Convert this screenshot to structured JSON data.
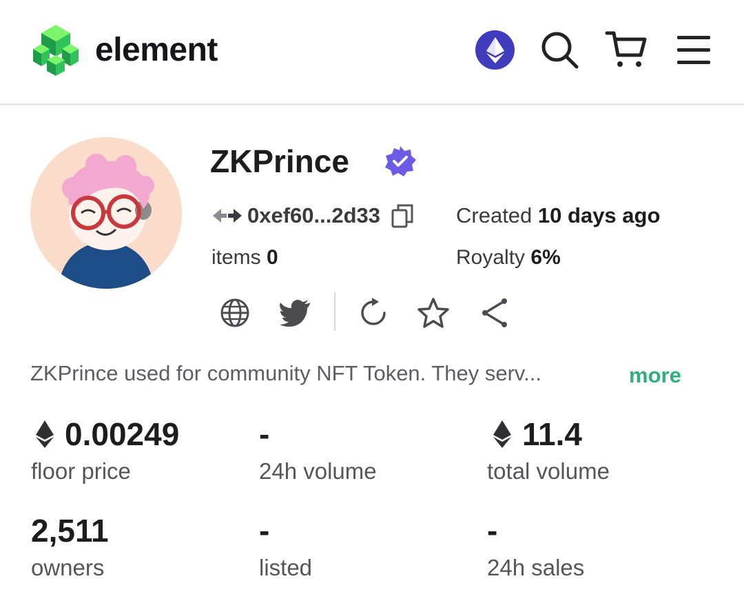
{
  "header": {
    "brand": "element",
    "icons": [
      "ethereum-network-icon",
      "search-icon",
      "cart-icon",
      "menu-icon"
    ]
  },
  "collection": {
    "name": "ZKPrince",
    "address": "0xef60...2d33",
    "created_label": "Created",
    "created_value": "10 days ago",
    "items_label": "items",
    "items_value": "0",
    "royalty_label": "Royalty",
    "royalty_value": "6%",
    "description": "ZKPrince used for community NFT Token. They serv...",
    "more_label": "more",
    "social_icons": [
      "globe-icon",
      "twitter-icon",
      "refresh-icon",
      "star-icon",
      "share-icon"
    ]
  },
  "stats": [
    {
      "value": "0.00249",
      "label": "floor price",
      "eth": true
    },
    {
      "value": "-",
      "label": "24h volume",
      "eth": false
    },
    {
      "value": "11.4",
      "label": "total volume",
      "eth": true
    },
    {
      "value": "2,511",
      "label": "owners",
      "eth": false
    },
    {
      "value": "-",
      "label": "listed",
      "eth": false
    },
    {
      "value": "-",
      "label": "24h sales",
      "eth": false
    }
  ],
  "colors": {
    "accent_green": "#2fae7e",
    "eth_button": "#3f3dbe",
    "verified_badge": "#6b5be6"
  }
}
